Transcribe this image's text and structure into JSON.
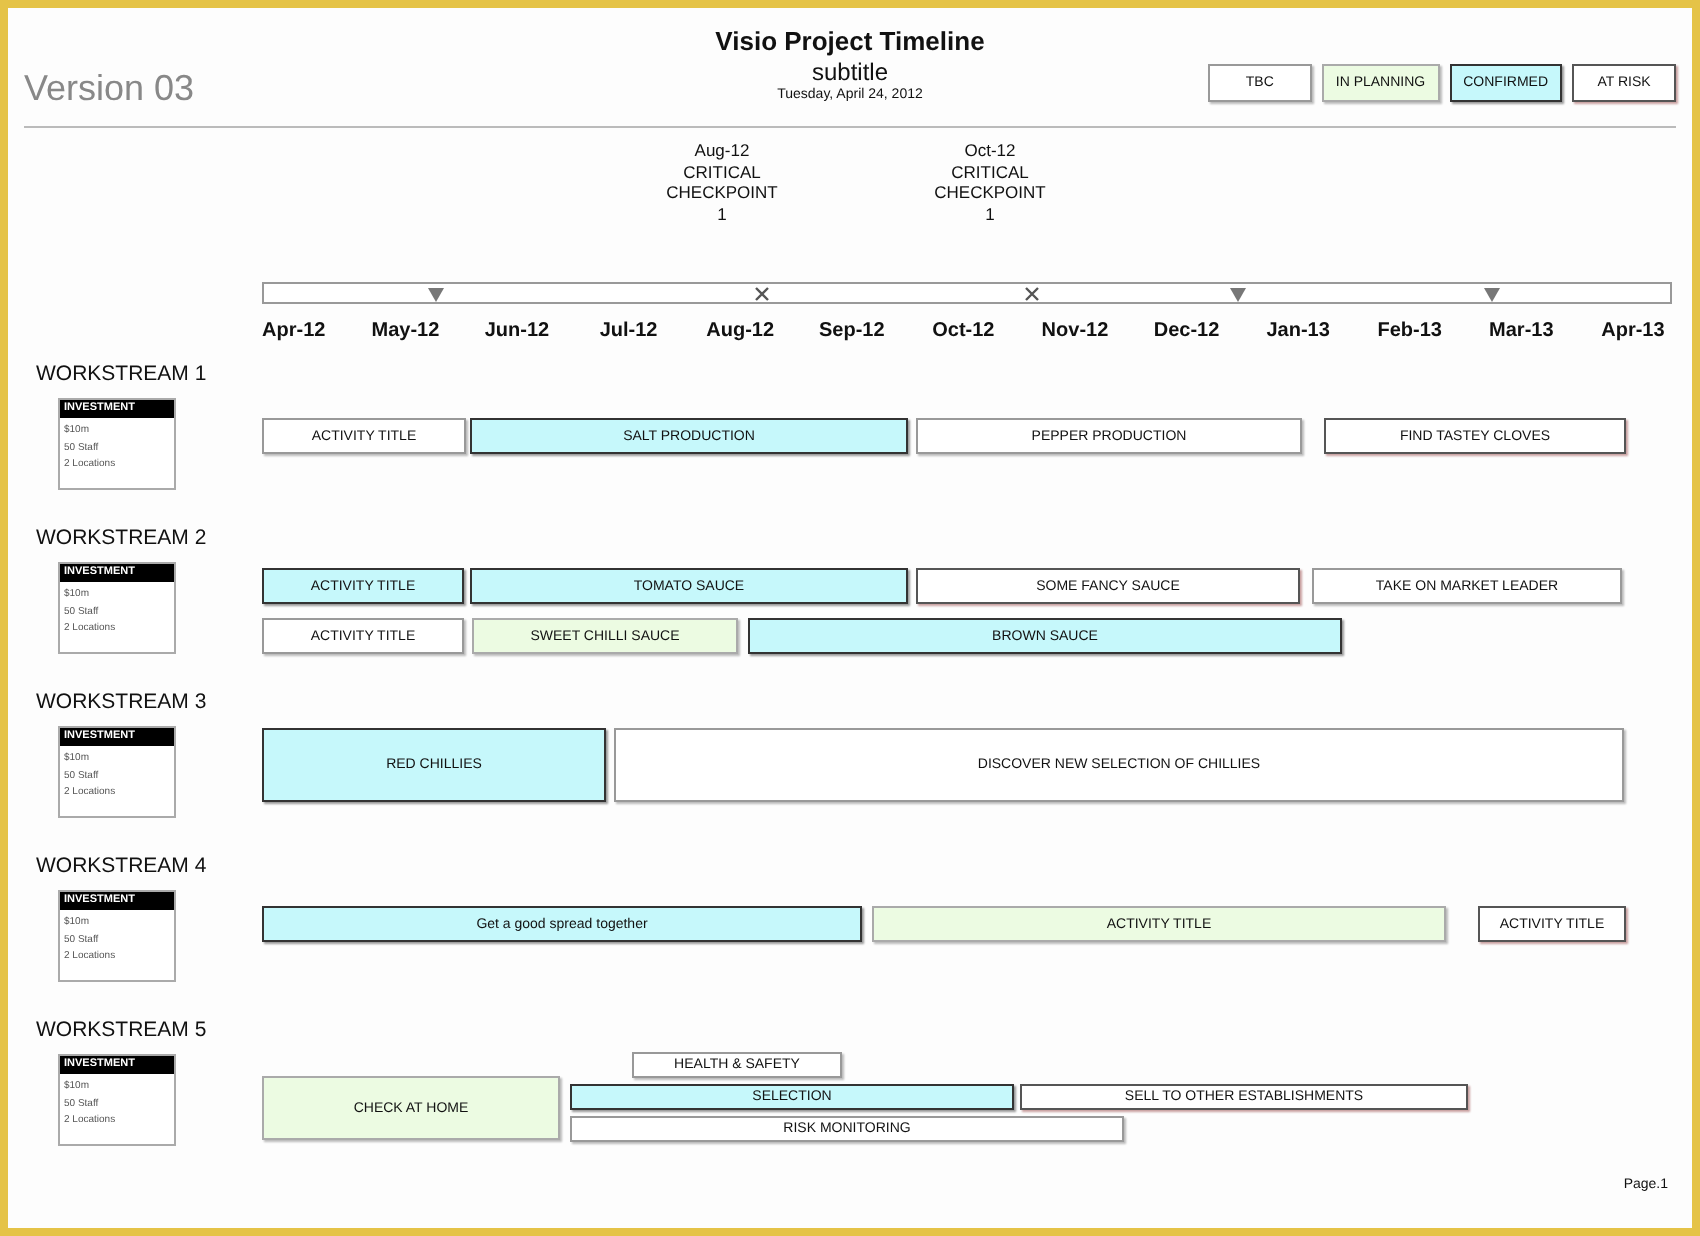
{
  "header": {
    "version": "Version 03",
    "title": "Visio Project Timeline",
    "subtitle": "subtitle",
    "date": "Tuesday, April 24, 2012"
  },
  "legend": [
    {
      "label": "TBC",
      "kind": "tbc"
    },
    {
      "label": "IN PLANNING",
      "kind": "planning"
    },
    {
      "label": "CONFIRMED",
      "kind": "confirmed"
    },
    {
      "label": "AT RISK",
      "kind": "risk"
    }
  ],
  "milestones": [
    {
      "lines": [
        "Aug-12",
        "CRITICAL",
        "CHECKPOINT",
        "1"
      ]
    },
    {
      "lines": [
        "Oct-12",
        "CRITICAL",
        "CHECKPOINT",
        "1"
      ]
    }
  ],
  "months": [
    "Apr-12",
    "May-12",
    "Jun-12",
    "Jul-12",
    "Aug-12",
    "Sep-12",
    "Oct-12",
    "Nov-12",
    "Dec-12",
    "Jan-13",
    "Feb-13",
    "Mar-13",
    "Apr-13"
  ],
  "workstreams": [
    {
      "title": "WORKSTREAM 1",
      "investment": {
        "heading": "INVESTMENT",
        "lines": [
          "$10m",
          "50 Staff",
          "2 Locations"
        ]
      },
      "activities": [
        {
          "label": "ACTIVITY TITLE",
          "kind": "tbc"
        },
        {
          "label": "SALT PRODUCTION",
          "kind": "confirmed"
        },
        {
          "label": "PEPPER PRODUCTION",
          "kind": "tbc"
        },
        {
          "label": "FIND TASTEY CLOVES",
          "kind": "risk"
        }
      ]
    },
    {
      "title": "WORKSTREAM 2",
      "investment": {
        "heading": "INVESTMENT",
        "lines": [
          "$10m",
          "50 Staff",
          "2 Locations"
        ]
      },
      "activities": [
        {
          "label": "ACTIVITY TITLE",
          "kind": "confirmed"
        },
        {
          "label": "TOMATO SAUCE",
          "kind": "confirmed"
        },
        {
          "label": "SOME FANCY SAUCE",
          "kind": "risk"
        },
        {
          "label": "TAKE ON MARKET LEADER",
          "kind": "tbc"
        },
        {
          "label": "ACTIVITY TITLE",
          "kind": "tbc"
        },
        {
          "label": "SWEET CHILLI SAUCE",
          "kind": "planning"
        },
        {
          "label": "BROWN SAUCE",
          "kind": "confirmed"
        }
      ]
    },
    {
      "title": "WORKSTREAM 3",
      "investment": {
        "heading": "INVESTMENT",
        "lines": [
          "$10m",
          "50 Staff",
          "2 Locations"
        ]
      },
      "activities": [
        {
          "label": "RED CHILLIES",
          "kind": "confirmed"
        },
        {
          "label": "DISCOVER NEW SELECTION OF CHILLIES",
          "kind": "tbc"
        }
      ]
    },
    {
      "title": "WORKSTREAM 4",
      "investment": {
        "heading": "INVESTMENT",
        "lines": [
          "$10m",
          "50 Staff",
          "2 Locations"
        ]
      },
      "activities": [
        {
          "label": "Get a good spread together",
          "kind": "confirmed"
        },
        {
          "label": "ACTIVITY TITLE",
          "kind": "planning"
        },
        {
          "label": "ACTIVITY TITLE",
          "kind": "risk"
        }
      ]
    },
    {
      "title": "WORKSTREAM 5",
      "investment": {
        "heading": "INVESTMENT",
        "lines": [
          "$10m",
          "50 Staff",
          "2 Locations"
        ]
      },
      "activities": [
        {
          "label": "HEALTH & SAFETY",
          "kind": "tbc"
        },
        {
          "label": "CHECK AT HOME",
          "kind": "planning"
        },
        {
          "label": "SELECTION",
          "kind": "confirmed"
        },
        {
          "label": "SELL TO OTHER ESTABLISHMENTS",
          "kind": "risk"
        },
        {
          "label": "RISK MONITORING",
          "kind": "tbc"
        }
      ]
    }
  ],
  "footer": {
    "page": "Page.1"
  }
}
